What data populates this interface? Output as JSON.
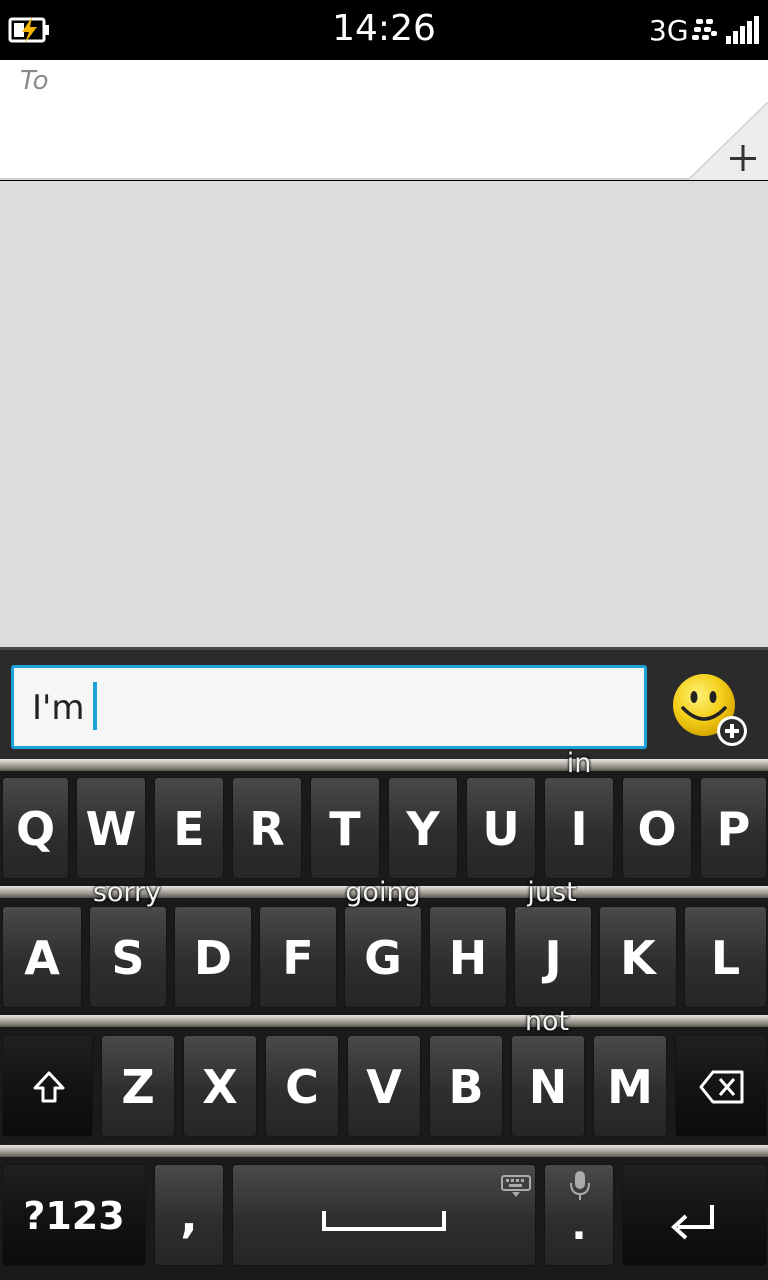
{
  "status_bar": {
    "time": "14:26",
    "network": "3G",
    "battery_icon": "battery-charging-icon",
    "blackberry_icon": "blackberry-icon",
    "signal_icon": "signal-bars-icon"
  },
  "recipient": {
    "label": "To",
    "add_icon": "plus-icon"
  },
  "compose": {
    "text": "I'm",
    "emoji_icon": "smiley-add-icon",
    "accent_color": "#1ca3dc"
  },
  "keyboard": {
    "row1": [
      "Q",
      "W",
      "E",
      "R",
      "T",
      "Y",
      "U",
      "I",
      "O",
      "P"
    ],
    "row2": [
      "A",
      "S",
      "D",
      "F",
      "G",
      "H",
      "J",
      "K",
      "L"
    ],
    "row3": [
      "Z",
      "X",
      "C",
      "V",
      "B",
      "N",
      "M"
    ],
    "suggestions": {
      "in": "in",
      "sorry": "sorry",
      "going": "going",
      "just": "just",
      "not": "not"
    },
    "symbols_label": "?123",
    "comma_label": ",",
    "period_label": "."
  }
}
